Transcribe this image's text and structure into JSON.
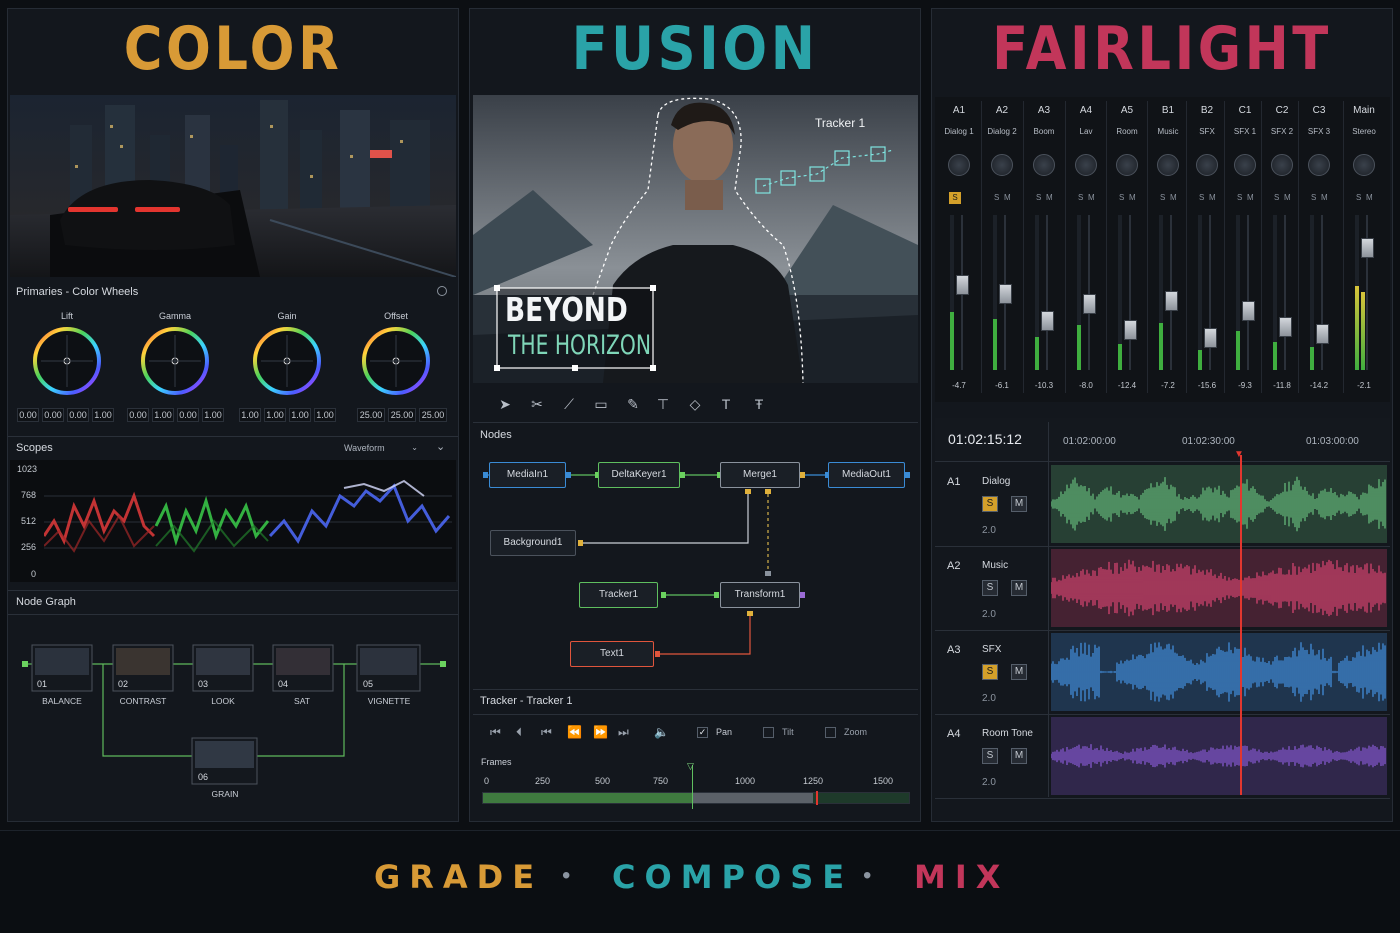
{
  "colors": {
    "color": "#d89a36",
    "fusion": "#2aa3a8",
    "fairlight": "#c2365a"
  },
  "color_page": {
    "title": "COLOR",
    "primaries_title": "Primaries - Color Wheels",
    "wheels": [
      {
        "label": "Lift",
        "values": [
          "0.00",
          "0.00",
          "0.00",
          "1.00"
        ]
      },
      {
        "label": "Gamma",
        "values": [
          "0.00",
          "1.00",
          "0.00",
          "1.00"
        ]
      },
      {
        "label": "Gain",
        "values": [
          "1.00",
          "1.00",
          "1.00",
          "1.00"
        ]
      },
      {
        "label": "Offset",
        "values": [
          "25.00",
          "25.00",
          "25.00"
        ]
      }
    ],
    "scopes_title": "Scopes",
    "scope_mode": "Waveform",
    "scope_ticks": [
      "1023",
      "768",
      "512",
      "256",
      "0"
    ],
    "node_graph_title": "Node Graph",
    "nodes": [
      {
        "num": "01",
        "label": "BALANCE"
      },
      {
        "num": "02",
        "label": "CONTRAST"
      },
      {
        "num": "03",
        "label": "LOOK"
      },
      {
        "num": "04",
        "label": "SAT"
      },
      {
        "num": "05",
        "label": "VIGNETTE"
      },
      {
        "num": "06",
        "label": "GRAIN"
      }
    ]
  },
  "fusion_page": {
    "title": "FUSION",
    "tracker_overlay": "Tracker 1",
    "text_line1": "BEYOND",
    "text_line2": "THE HORIZON",
    "nodes_title": "Nodes",
    "nodes": {
      "mediain": "MediaIn1",
      "deltakeyer": "DeltaKeyer1",
      "merge": "Merge1",
      "mediaout": "MediaOut1",
      "background": "Background1",
      "tracker": "Tracker1",
      "transform": "Transform1",
      "text": "Text1"
    },
    "tracker_panel_title": "Tracker - Tracker 1",
    "options": [
      {
        "label": "Pan",
        "checked": true
      },
      {
        "label": "Tilt",
        "checked": false
      },
      {
        "label": "Zoom",
        "checked": false
      }
    ],
    "frames_label": "Frames",
    "frame_ticks": [
      "0",
      "250",
      "500",
      "750",
      "1000",
      "1250",
      "1500"
    ]
  },
  "fairlight_page": {
    "title": "FAIRLIGHT",
    "channels": [
      {
        "id": "A1",
        "name": "Dialog 1",
        "db": "-4.7",
        "level": 0.62
      },
      {
        "id": "A2",
        "name": "Dialog 2",
        "db": "-6.1",
        "level": 0.55
      },
      {
        "id": "A3",
        "name": "Boom",
        "db": "-10.3",
        "level": 0.35
      },
      {
        "id": "A4",
        "name": "Lav",
        "db": "-8.0",
        "level": 0.48
      },
      {
        "id": "A5",
        "name": "Room",
        "db": "-12.4",
        "level": 0.28
      },
      {
        "id": "B1",
        "name": "Music",
        "db": "-7.2",
        "level": 0.5
      },
      {
        "id": "B2",
        "name": "SFX",
        "db": "-15.6",
        "level": 0.22
      },
      {
        "id": "C1",
        "name": "SFX 1",
        "db": "-9.3",
        "level": 0.42
      },
      {
        "id": "C2",
        "name": "SFX 2",
        "db": "-11.8",
        "level": 0.3
      },
      {
        "id": "C3",
        "name": "SFX 3",
        "db": "-14.2",
        "level": 0.25
      },
      {
        "id": "Main",
        "name": "Stereo",
        "db": "-2.1",
        "level": 0.9
      }
    ],
    "solo": "S",
    "mute": "M",
    "timecode": "01:02:15:12",
    "ruler": [
      "01:02:00:00",
      "01:02:30:00",
      "01:03:00:00"
    ],
    "tracks": [
      {
        "id": "A1",
        "name": "Dialog",
        "vol": "2.0",
        "color": "#5fae74"
      },
      {
        "id": "A2",
        "name": "Music",
        "vol": "2.0",
        "color": "#c8416a"
      },
      {
        "id": "A3",
        "name": "SFX",
        "vol": "2.0",
        "color": "#3f86d0"
      },
      {
        "id": "A4",
        "name": "Room Tone",
        "vol": "2.0",
        "color": "#7d54c4"
      }
    ]
  },
  "footer": {
    "grade": "GRADE",
    "compose": "COMPOSE",
    "mix": "MIX",
    "sep": "•"
  }
}
